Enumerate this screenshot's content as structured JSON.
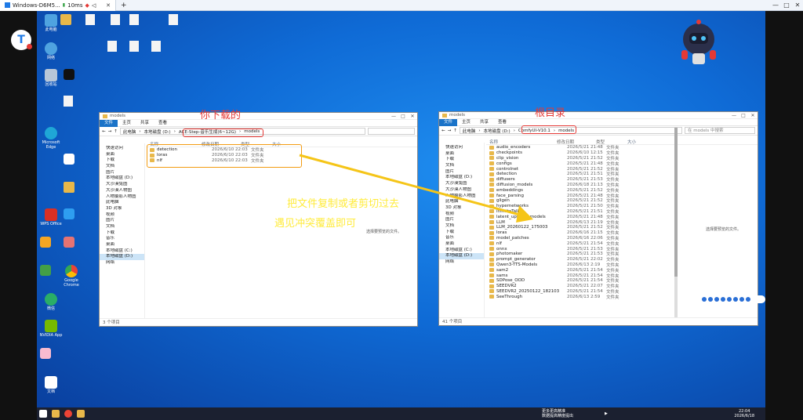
{
  "remote": {
    "tab_title": "Windows-D6M5...",
    "signal": "10ms",
    "plus": "+",
    "win_min": "—",
    "win_max": "□",
    "win_close": "✕"
  },
  "logo": {
    "letter": "T"
  },
  "desktop_icons": [
    {
      "label": "此电脑",
      "color": "#4fa3e0"
    },
    {
      "label": "回收站",
      "color": "#b8c7d8"
    },
    {
      "label": "Microsoft Edge",
      "color": "#1fa7d6"
    },
    {
      "label": "网络",
      "color": "#4fa3e0"
    },
    {
      "label": "Google Chrome",
      "color": "#e8e8e8"
    },
    {
      "label": "WPS Office",
      "color": "#d93025"
    },
    {
      "label": "微信",
      "color": "#2aae67"
    },
    {
      "label": "NVIDIA App",
      "color": "#76b900"
    },
    {
      "label": "文档",
      "color": "#ffffff"
    }
  ],
  "left_window": {
    "title": "models",
    "ribbon": [
      "文件",
      "主页",
      "共享",
      "查看"
    ],
    "path": [
      "此电脑",
      "本地磁盘 (D:)",
      "ACE-Step-音乐生成(6~12G)",
      "models"
    ],
    "search_placeholder": "",
    "nav": [
      "快速访问",
      "桌面",
      "下载",
      "文档",
      "图片",
      "本地磁盘 (D:)",
      "大沙漠兔图",
      "大沙漠人物图",
      "人物摄影人物图",
      "此电脑",
      "3D 对象",
      "视频",
      "图片",
      "文档",
      "下载",
      "音乐",
      "桌面",
      "本地磁盘 (C:)",
      "本地磁盘 (D:)",
      "网络"
    ],
    "headers": [
      "名称",
      "修改日期",
      "类型",
      "大小"
    ],
    "files": [
      {
        "name": "detection",
        "date": "2026/6/10 22:03",
        "type": "文件夹"
      },
      {
        "name": "loras",
        "date": "2026/6/10 22:03",
        "type": "文件夹"
      },
      {
        "name": "nlf",
        "date": "2026/6/10 22:03",
        "type": "文件夹"
      }
    ],
    "status": "3 个项目",
    "preview_note": "选择要预览的文件。"
  },
  "right_window": {
    "title": "models",
    "ribbon": [
      "文件",
      "主页",
      "共享",
      "查看"
    ],
    "path": [
      "此电脑",
      "本地磁盘 (D:)",
      "ComfyUI-V10.1",
      "models"
    ],
    "search_placeholder": "在 models 中搜索",
    "nav": [
      "快速访问",
      "桌面",
      "下载",
      "文档",
      "图片",
      "本地磁盘 (D:)",
      "大沙漠兔图",
      "大沙漠人物图",
      "人物摄影人物图",
      "此电脑",
      "3D 对象",
      "视频",
      "图片",
      "文档",
      "下载",
      "音乐",
      "桌面",
      "本地磁盘 (C:)",
      "本地磁盘 (D:)",
      "网络"
    ],
    "headers": [
      "名称",
      "修改日期",
      "类型",
      "大小"
    ],
    "files": [
      {
        "name": "audio_encoders",
        "date": "2026/5/21 21:48",
        "type": "文件夹"
      },
      {
        "name": "checkpoints",
        "date": "2026/6/10 12:15",
        "type": "文件夹"
      },
      {
        "name": "clip_vision",
        "date": "2026/5/21 21:52",
        "type": "文件夹"
      },
      {
        "name": "configs",
        "date": "2026/5/21 21:48",
        "type": "文件夹"
      },
      {
        "name": "controlnet",
        "date": "2026/5/21 21:52",
        "type": "文件夹"
      },
      {
        "name": "detection",
        "date": "2026/5/21 21:51",
        "type": "文件夹"
      },
      {
        "name": "diffusers",
        "date": "2026/5/21 21:53",
        "type": "文件夹"
      },
      {
        "name": "diffusion_models",
        "date": "2026/6/18 21:13",
        "type": "文件夹"
      },
      {
        "name": "embeddings",
        "date": "2026/5/21 21:52",
        "type": "文件夹"
      },
      {
        "name": "face_parsing",
        "date": "2026/5/21 21:48",
        "type": "文件夹"
      },
      {
        "name": "gligen",
        "date": "2026/5/21 21:52",
        "type": "文件夹"
      },
      {
        "name": "hypernetworks",
        "date": "2026/5/21 21:50",
        "type": "文件夹"
      },
      {
        "name": "InfiniteTalk",
        "date": "2026/5/21 21:51",
        "type": "文件夹"
      },
      {
        "name": "latent_upscale_models",
        "date": "2026/5/21 21:48",
        "type": "文件夹"
      },
      {
        "name": "LLM",
        "date": "2026/6/13 21:19",
        "type": "文件夹"
      },
      {
        "name": "LLM_20260122_175003",
        "date": "2026/5/21 21:52",
        "type": "文件夹"
      },
      {
        "name": "loras",
        "date": "2026/6/16 21:15",
        "type": "文件夹"
      },
      {
        "name": "model_patches",
        "date": "2026/6/16 22:06",
        "type": "文件夹"
      },
      {
        "name": "nlf",
        "date": "2026/5/21 21:54",
        "type": "文件夹"
      },
      {
        "name": "onnx",
        "date": "2026/5/21 21:53",
        "type": "文件夹"
      },
      {
        "name": "photomaker",
        "date": "2026/5/21 21:53",
        "type": "文件夹"
      },
      {
        "name": "prompt_generator",
        "date": "2026/5/21 22:02",
        "type": "文件夹"
      },
      {
        "name": "Qwen3-TTS-Models",
        "date": "2026/6/13 2:19",
        "type": "文件夹"
      },
      {
        "name": "sam2",
        "date": "2026/5/21 21:54",
        "type": "文件夹"
      },
      {
        "name": "sams",
        "date": "2026/5/21 21:54",
        "type": "文件夹"
      },
      {
        "name": "SDPose_OOD",
        "date": "2026/5/21 21:54",
        "type": "文件夹"
      },
      {
        "name": "SEEDVR2",
        "date": "2026/5/21 22:07",
        "type": "文件夹"
      },
      {
        "name": "SEEDVR2_20250122_182103",
        "date": "2026/5/21 21:54",
        "type": "文件夹"
      },
      {
        "name": "SeeThrough",
        "date": "2026/6/13 2:59",
        "type": "文件夹"
      }
    ],
    "status": "41 个项目",
    "preview_note": "选择要预览的文件。"
  },
  "annotations": {
    "download_label": "你下载的",
    "root_label": "根目录",
    "instruction_1": "把文件复制或者剪切过去",
    "instruction_2": "遇见冲突覆盖即可"
  },
  "taskbar": {
    "time": "22:04",
    "date": "2026/6/18",
    "tray_text_1": "更多更高精准",
    "tray_text_2": "数据提高精度提出"
  },
  "colors": {
    "arrow": "#f5c518",
    "download_label": "#e53935",
    "root_label": "#e53935",
    "instruction": "#ffeb3b",
    "highlight_orange": "#f39c12",
    "highlight_red": "#e53935"
  }
}
